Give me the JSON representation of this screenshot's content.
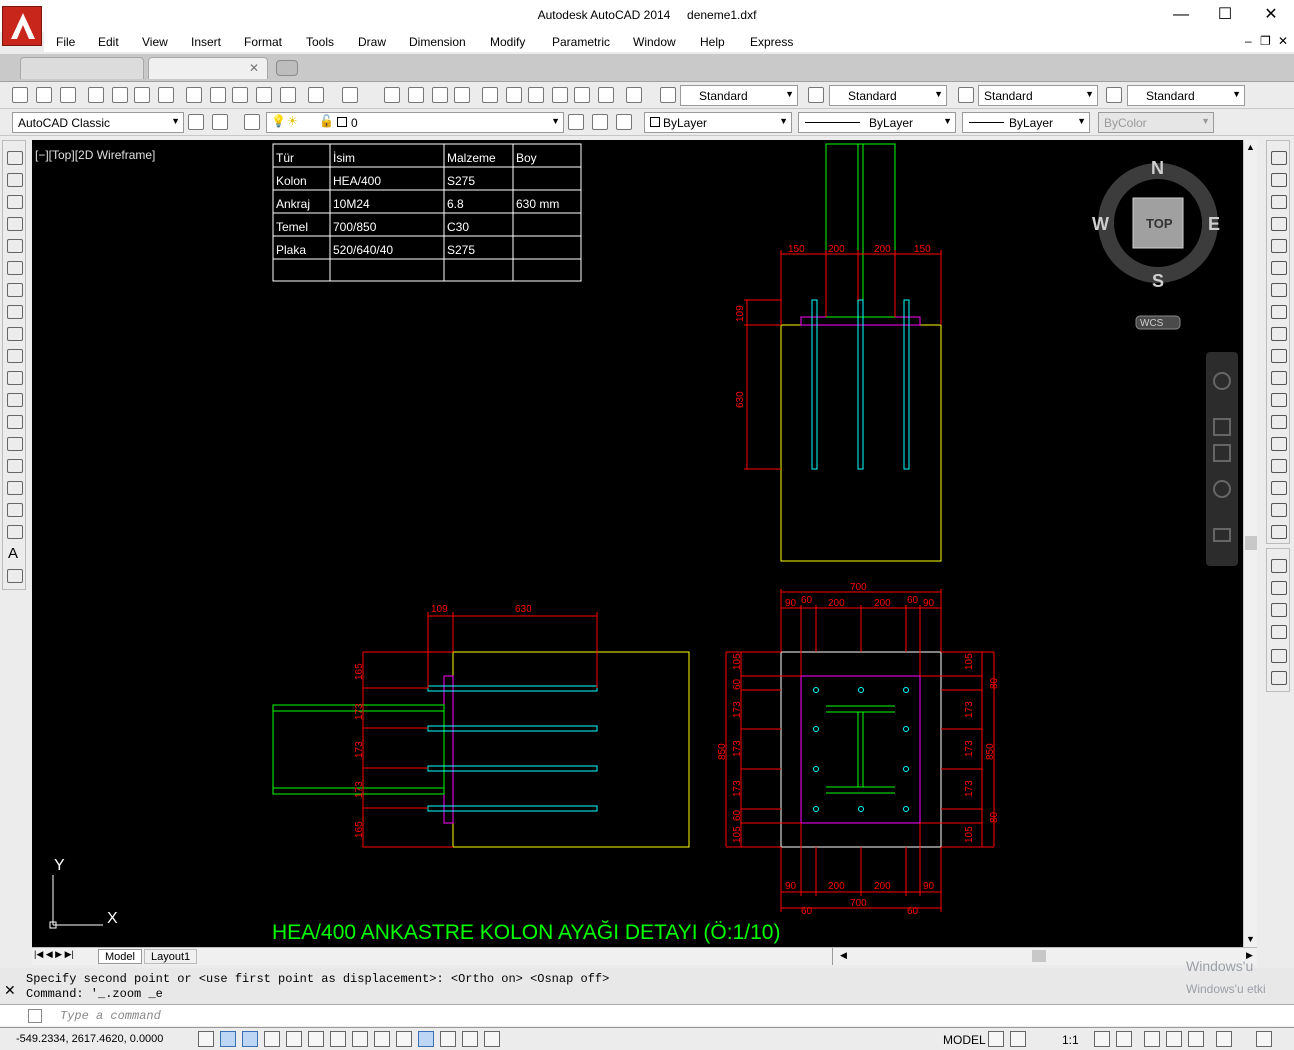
{
  "window": {
    "app_title": "Autodesk AutoCAD 2014",
    "doc_title": "deneme1.dxf",
    "minimize": "—",
    "maximize": "☐",
    "close": "✕"
  },
  "menu": [
    "File",
    "Edit",
    "View",
    "Insert",
    "Format",
    "Tools",
    "Draw",
    "Dimension",
    "Modify",
    "Parametric",
    "Window",
    "Help",
    "Express"
  ],
  "toolbar": {
    "text_style": "Standard",
    "dim_style": "Standard",
    "table_style": "Standard",
    "mleader_style": "Standard",
    "workspace": "AutoCAD Classic",
    "layer": "0",
    "color": "ByLayer",
    "linetype": "ByLayer",
    "lineweight": "ByLayer",
    "plotstyle": "ByColor"
  },
  "viewport": {
    "label": "[−][Top][2D Wireframe]",
    "compass": {
      "n": "N",
      "s": "S",
      "e": "E",
      "w": "W",
      "top": "TOP",
      "wcs": "WCS"
    },
    "ucs": {
      "x": "X",
      "y": "Y"
    }
  },
  "bom_table": {
    "headers": [
      "Tür",
      "İsim",
      "Malzeme",
      "Boy"
    ],
    "rows": [
      [
        "Kolon",
        "HEA/400",
        "S275",
        ""
      ],
      [
        "Ankraj",
        "10M24",
        "6.8",
        "630 mm"
      ],
      [
        "Temel",
        "700/850",
        "C30",
        ""
      ],
      [
        "Plaka",
        "520/640/40",
        "S275",
        ""
      ],
      [
        "",
        "",
        "",
        ""
      ]
    ]
  },
  "dims": {
    "d150": "150",
    "d200": "200",
    "d109": "109",
    "d630": "630",
    "d700": "700",
    "d90": "90",
    "d60": "60",
    "d165": "165",
    "d173": "173",
    "d105": "105",
    "d850": "850",
    "d80": "80"
  },
  "drawing_title": "HEA/400 ANKASTRE KOLON AYAĞI DETAYI (Ö:1/10)",
  "layout_tabs": {
    "model": "Model",
    "layout1": "Layout1"
  },
  "command_history": [
    "Specify second point or <use first point as displacement>:  <Ortho on>  <Osnap off>",
    "Command: '_.zoom _e"
  ],
  "command_placeholder": "Type a command",
  "status": {
    "coords": "-549.2334, 2617.4620, 0.0000",
    "space": "MODEL",
    "annotation_scale": "1:1"
  },
  "watermark": {
    "line1": "Windows'u",
    "line2": "Windows'u etki"
  },
  "colors": {
    "red": "#ff0000",
    "yellow": "#ffff00",
    "green": "#00ff00",
    "cyan": "#00ffff",
    "magenta": "#ff00ff",
    "white": "#ffffff"
  }
}
